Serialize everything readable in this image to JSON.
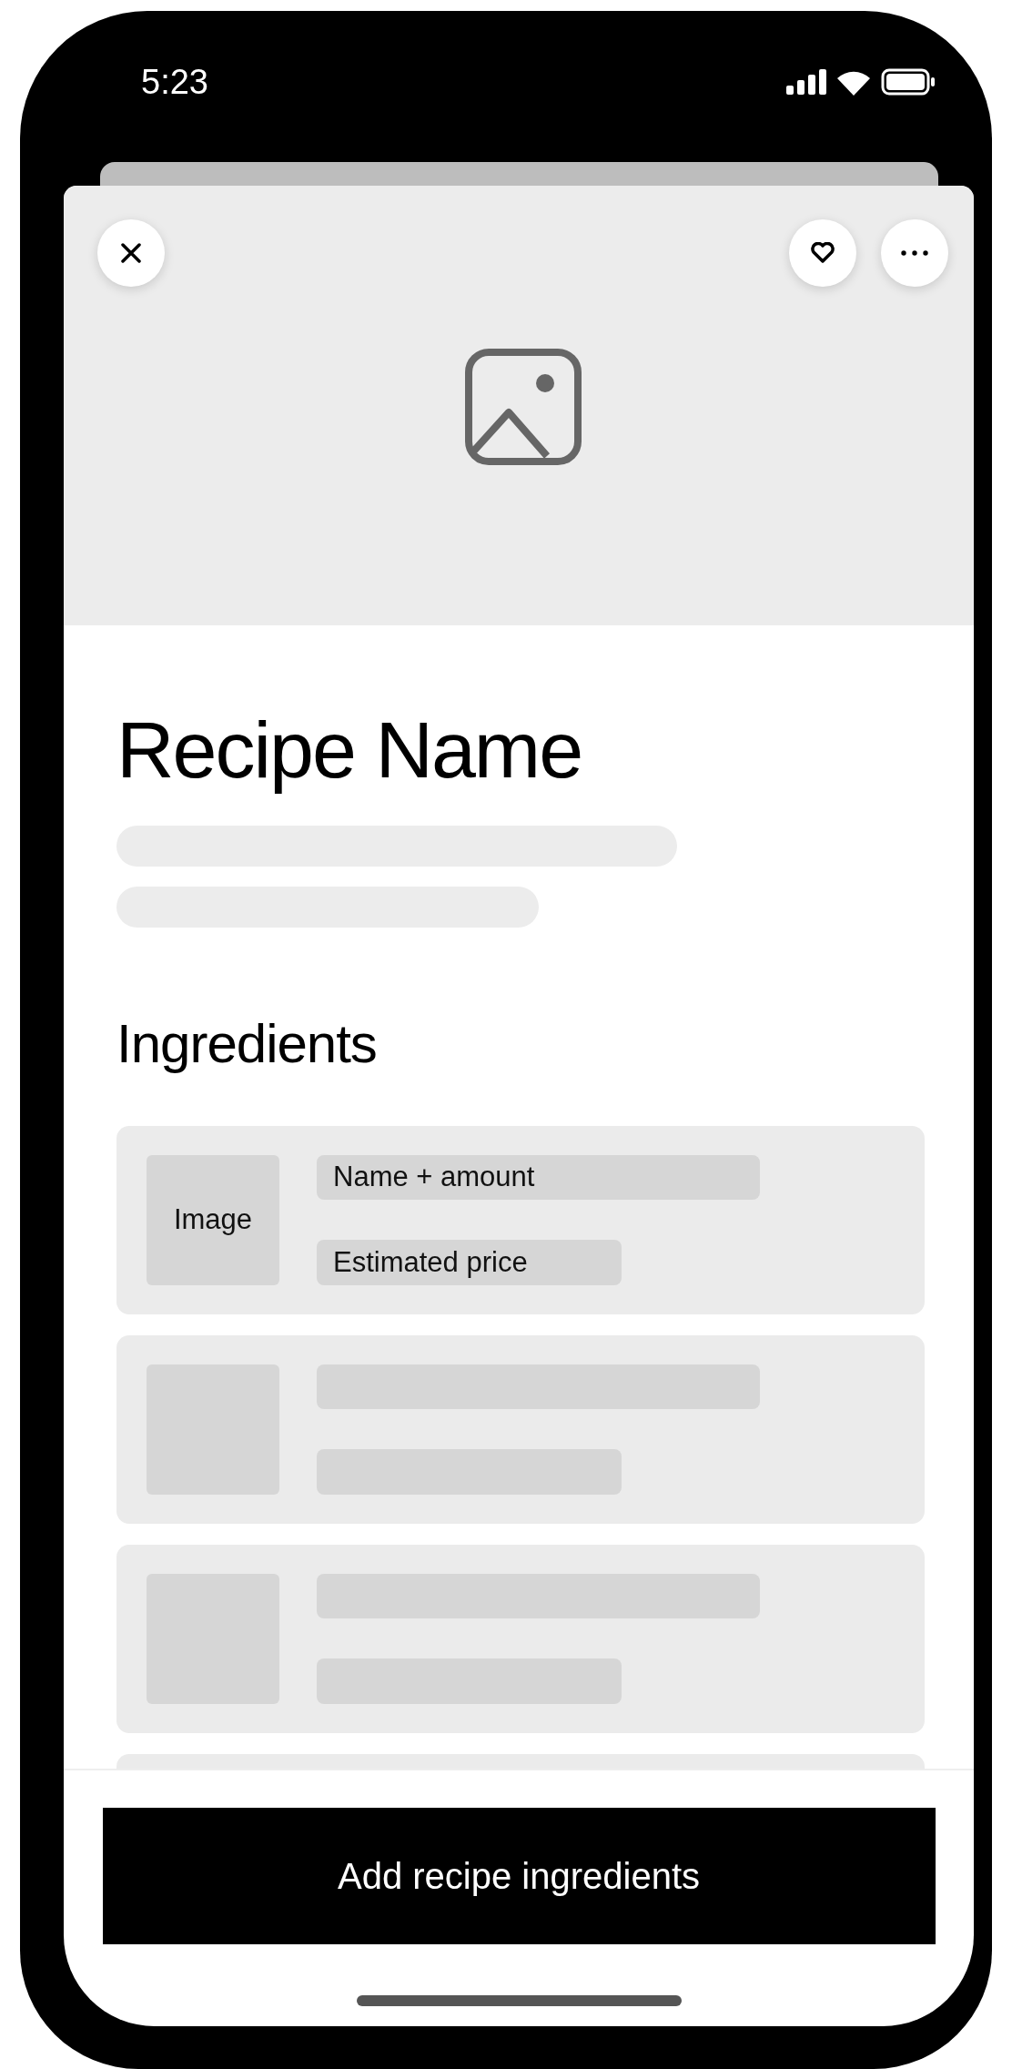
{
  "status_bar": {
    "time": "5:23"
  },
  "recipe": {
    "title": "Recipe Name",
    "section_title": "Ingredients"
  },
  "ingredients": [
    {
      "kind": "labeled",
      "image_label": "Image",
      "name": "Name + amount",
      "price": "Estimated price"
    },
    {
      "kind": "placeholder"
    },
    {
      "kind": "placeholder"
    },
    {
      "kind": "peek"
    }
  ],
  "primary_button": {
    "label": "Add recipe ingredients"
  }
}
